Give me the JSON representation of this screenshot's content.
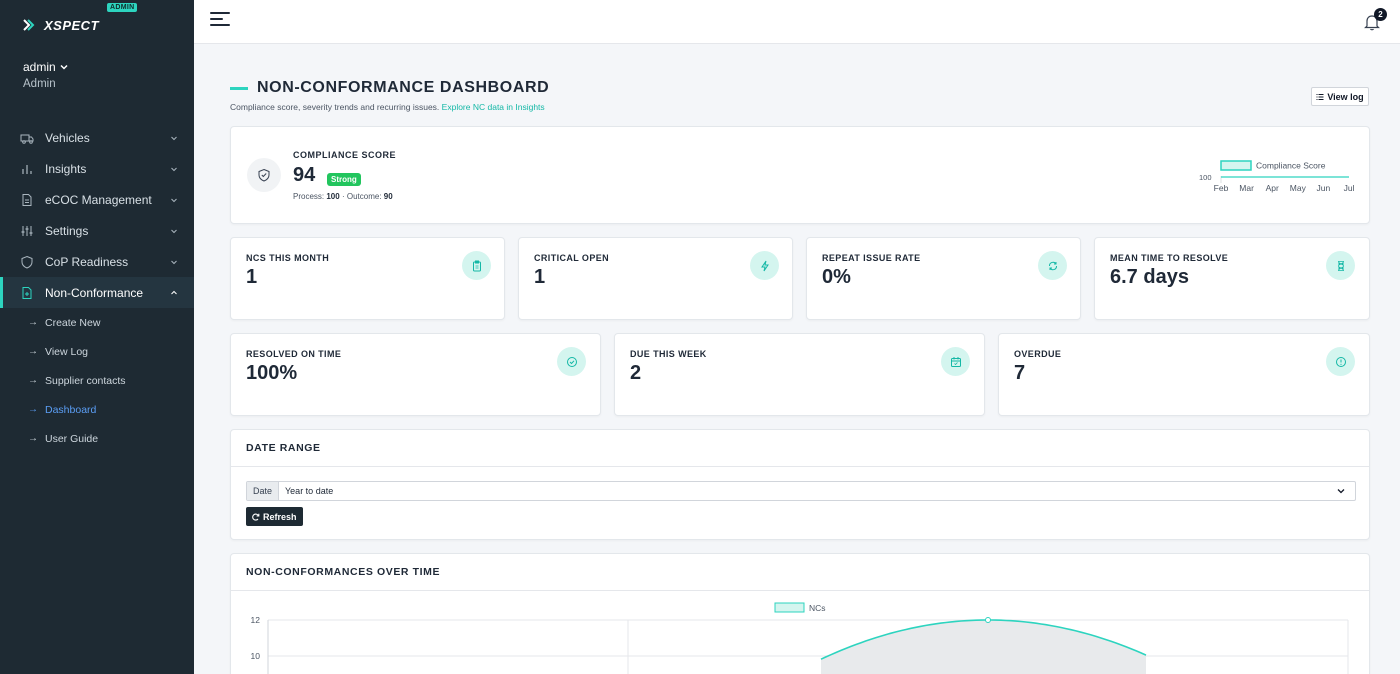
{
  "brand": {
    "name": "XSPECT",
    "badge": "ADMIN"
  },
  "user": {
    "name": "admin",
    "role": "Admin"
  },
  "sidebar": {
    "items": [
      {
        "label": "Vehicles",
        "icon": "truck-icon"
      },
      {
        "label": "Insights",
        "icon": "bar-chart-icon"
      },
      {
        "label": "eCOC Management",
        "icon": "document-icon"
      },
      {
        "label": "Settings",
        "icon": "sliders-icon"
      },
      {
        "label": "CoP Readiness",
        "icon": "shield-icon"
      },
      {
        "label": "Non-Conformance",
        "icon": "file-plus-icon"
      }
    ],
    "subitems": [
      {
        "label": "Create New"
      },
      {
        "label": "View Log"
      },
      {
        "label": "Supplier contacts"
      },
      {
        "label": "Dashboard"
      },
      {
        "label": "User Guide"
      }
    ]
  },
  "topbar": {
    "notification_count": "2"
  },
  "header": {
    "title": "NON-CONFORMANCE DASHBOARD",
    "subtitle": "Compliance score, severity trends and recurring issues.",
    "subtitle_link": "Explore NC data in Insights",
    "view_log": "View log"
  },
  "compliance": {
    "label": "COMPLIANCE SCORE",
    "value": "94",
    "badge": "Strong",
    "process_label": "Process:",
    "process_value": "100",
    "separator": "·",
    "outcome_label": "Outcome:",
    "outcome_value": "90",
    "legend": "Compliance Score",
    "y_tick": "100",
    "months": [
      "Feb",
      "Mar",
      "Apr",
      "May",
      "Jun",
      "Jul"
    ]
  },
  "stats_row1": [
    {
      "label": "NCS THIS MONTH",
      "value": "1",
      "icon": "clipboard-icon"
    },
    {
      "label": "CRITICAL OPEN",
      "value": "1",
      "icon": "lightning-icon"
    },
    {
      "label": "REPEAT ISSUE RATE",
      "value": "0%",
      "icon": "refresh-icon"
    },
    {
      "label": "MEAN TIME TO RESOLVE",
      "value": "6.7 days",
      "icon": "hourglass-icon"
    }
  ],
  "stats_row2": [
    {
      "label": "RESOLVED ON TIME",
      "value": "100%",
      "icon": "check-circle-icon"
    },
    {
      "label": "DUE THIS WEEK",
      "value": "2",
      "icon": "calendar-icon"
    },
    {
      "label": "OVERDUE",
      "value": "7",
      "icon": "alert-circle-icon"
    }
  ],
  "date_range": {
    "title": "DATE RANGE",
    "addon": "Date",
    "selected": "Year to date",
    "refresh": "Refresh"
  },
  "chart_section": {
    "title": "NON-CONFORMANCES OVER TIME"
  },
  "chart_data": {
    "type": "area",
    "title": "NON-CONFORMANCES OVER TIME",
    "series": [
      {
        "name": "NCs",
        "color": "#2dd4bf"
      }
    ],
    "y_ticks_visible": [
      12,
      10
    ],
    "peak_value": 12
  },
  "colors": {
    "accent": "#2dd4bf",
    "sidebar": "#1e2a33",
    "badge_green": "#22c55e",
    "link": "#14b8a6"
  }
}
